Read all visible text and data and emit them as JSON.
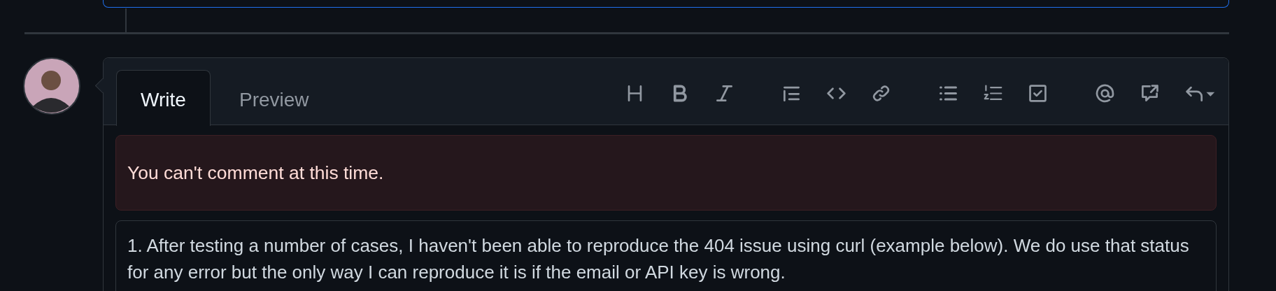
{
  "comment_box": {
    "tabs": [
      {
        "label": "Write",
        "selected": true
      },
      {
        "label": "Preview",
        "selected": false
      }
    ],
    "error_banner": "You can't comment at this time.",
    "comment_text": "1. After testing a number of cases, I haven't been able to reproduce the 404 issue using curl (example below). We do use that status for any error but the only way I can reproduce it is if the email or API key is wrong."
  }
}
